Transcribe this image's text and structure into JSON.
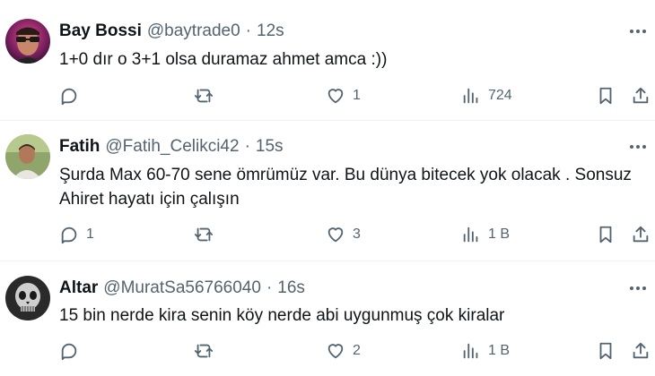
{
  "tweets": [
    {
      "name": "Bay Bossi",
      "handle": "@baytrade0",
      "time": "12s",
      "text": "1+0 dır o 3+1 olsa duramaz ahmet amca :))",
      "replies": "",
      "retweets": "",
      "likes": "1",
      "views": "724"
    },
    {
      "name": "Fatih",
      "handle": "@Fatih_Celikci42",
      "time": "15s",
      "text": "Şurda Max 60-70 sene ömrümüz var. Bu dünya bitecek yok olacak . Sonsuz\nAhiret hayatı için çalışın",
      "replies": "1",
      "retweets": "",
      "likes": "3",
      "views": "1 B"
    },
    {
      "name": "Altar",
      "handle": "@MuratSa56766040",
      "time": "16s",
      "text": "15 bin nerde kira senin köy nerde abi uygunmuş çok kiralar",
      "replies": "",
      "retweets": "",
      "likes": "2",
      "views": "1 B"
    }
  ],
  "separator": "·"
}
